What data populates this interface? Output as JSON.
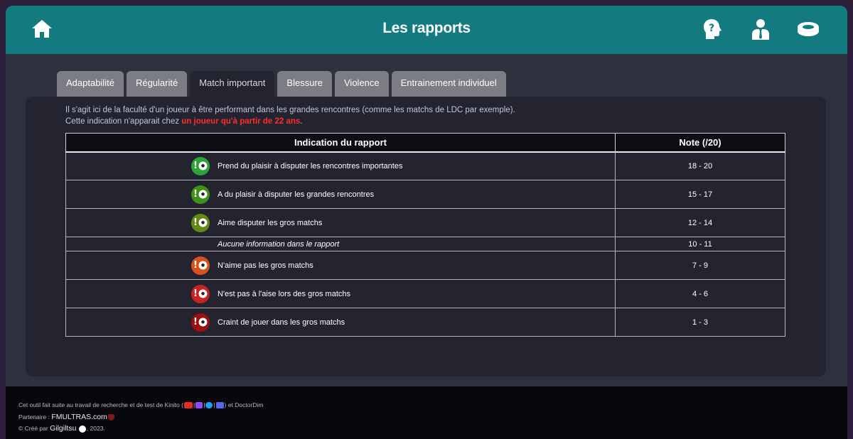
{
  "header": {
    "title": "Les rapports",
    "icons": [
      "home-icon",
      "head-question-icon",
      "manager-icon",
      "stadium-icon"
    ]
  },
  "tabs": [
    {
      "label": "Adaptabilité",
      "active": false
    },
    {
      "label": "Régularité",
      "active": false
    },
    {
      "label": "Match important",
      "active": true
    },
    {
      "label": "Blessure",
      "active": false
    },
    {
      "label": "Violence",
      "active": false
    },
    {
      "label": "Entrainement individuel",
      "active": false
    }
  ],
  "intro": {
    "line1": "Il s'agit ici de la faculté d'un joueur à être performant dans les grandes rencontres (comme les matchs de LDC par exemple).",
    "line2_prefix": "Cette indication n'apparait chez ",
    "line2_highlight": "un joueur qu'à partir de 22 ans",
    "line2_suffix": "."
  },
  "table": {
    "headers": {
      "indication": "Indication du rapport",
      "note": "Note (/20)"
    },
    "rows": [
      {
        "text": "Prend du plaisir à disputer les rencontres importantes",
        "note": "18 - 20",
        "color": "#2fa33a",
        "icon": "exclamation-football-icon"
      },
      {
        "text": "A du plaisir à disputer les grandes rencontres",
        "note": "15 - 17",
        "color": "#3c9216",
        "icon": "exclamation-football-icon"
      },
      {
        "text": "Aime disputer les gros matchs",
        "note": "12 - 14",
        "color": "#628a12",
        "icon": "exclamation-football-icon"
      },
      {
        "text": "Aucune information dans le rapport",
        "note": "10 - 11",
        "color": "",
        "icon": ""
      },
      {
        "text": "N'aime pas les gros matchs",
        "note": "7 - 9",
        "color": "#d8521d",
        "icon": "exclamation-football-icon"
      },
      {
        "text": "N'est pas à l'aise lors des gros matchs",
        "note": "4 - 6",
        "color": "#c82323",
        "icon": "exclamation-football-icon"
      },
      {
        "text": "Craint de jouer dans les gros matchs",
        "note": "1 - 3",
        "color": "#9e1010",
        "icon": "exclamation-football-icon"
      }
    ]
  },
  "footer": {
    "line1_prefix": "Cet outil fait suite au travail de recherche et de test de Kinito (",
    "line1_sep": "|",
    "line1_suffix": ") et DoctorDim",
    "line1_icons": [
      "youtube-icon",
      "twitch-icon",
      "twitter-icon",
      "discord-icon"
    ],
    "line2_prefix": "Partenaire : ",
    "line2_link": "FMULTRAS.com",
    "line3_prefix": "© Créé par ",
    "line3_author": "Gilgiltsu",
    "line3_suffix": ", 2023.",
    "colors": {
      "youtube": "#e52d27",
      "twitch": "#9146ff",
      "twitter": "#1da1f2",
      "discord": "#5865f2"
    }
  }
}
